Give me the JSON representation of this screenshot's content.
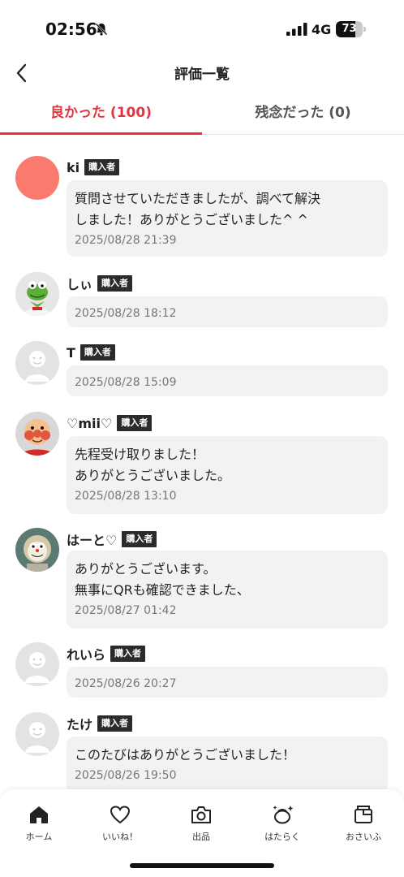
{
  "status_bar": {
    "time": "02:56",
    "network": "4G",
    "battery": "73",
    "battery_level": 0.73
  },
  "header": {
    "title": "評価一覧",
    "back_icon": "chevron-left-icon"
  },
  "tabs": [
    {
      "label": "良かった (100)",
      "active": true
    },
    {
      "label": "残念だった (0)",
      "active": false
    }
  ],
  "colors": {
    "accent": "#e5343f",
    "badge": "#2b2b2b",
    "bubble": "#f2f2f2"
  },
  "reviews": [
    {
      "name": "ki",
      "badge": "購入者",
      "comment": "質問させていただきましたが、調べて解決\nしました！ありがとうございました^ ^",
      "date": "2025/08/28 21:39",
      "avatar": "salmon-circle"
    },
    {
      "name": "しぃ",
      "badge": "購入者",
      "comment": "",
      "date": "2025/08/28 18:12",
      "avatar": "green-frog"
    },
    {
      "name": "T",
      "badge": "購入者",
      "comment": "",
      "date": "2025/08/28 15:09",
      "avatar": "default-person"
    },
    {
      "name": "♡mii♡",
      "badge": "購入者",
      "comment": "先程受け取りました！\nありがとうございました。",
      "date": "2025/08/28 13:10",
      "avatar": "bread-hero"
    },
    {
      "name": "はーと♡",
      "badge": "購入者",
      "comment": "ありがとうございます。\n無事にQRも確認できました、",
      "date": "2025/08/27 01:42",
      "avatar": "cat-robot"
    },
    {
      "name": "れいら",
      "badge": "購入者",
      "comment": "",
      "date": "2025/08/26 20:27",
      "avatar": "default-person"
    },
    {
      "name": "たけ",
      "badge": "購入者",
      "comment": "このたびはありがとうございました！",
      "date": "2025/08/26 19:50",
      "avatar": "default-person"
    }
  ],
  "bottom_nav": [
    {
      "label": "ホーム",
      "icon": "home-icon"
    },
    {
      "label": "いいね！",
      "icon": "heart-icon"
    },
    {
      "label": "出品",
      "icon": "camera-icon"
    },
    {
      "label": "はたらく",
      "icon": "sparkle-bag-icon"
    },
    {
      "label": "おさいふ",
      "icon": "wallet-icon"
    }
  ]
}
